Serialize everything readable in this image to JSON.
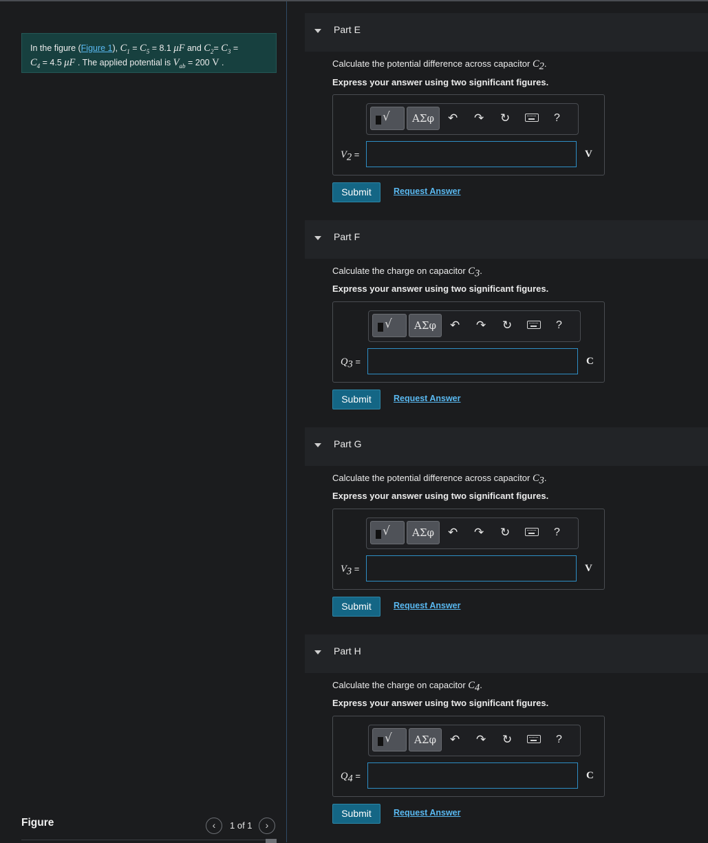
{
  "problem": {
    "intro": "In the figure (",
    "figure_link": "Figure 1",
    "after_link": "), ",
    "c1": "C",
    "c1_sub": "1",
    "eq1": " = ",
    "c5": "C",
    "c5_sub": "5",
    "eq2": " = 8.1 ",
    "unit_uf1": "μF",
    "and": " and ",
    "c2": "C",
    "c2_sub": "2",
    "eq3": "= ",
    "c3": "C",
    "c3_sub": "3",
    "eq4": " = ",
    "c4": "C",
    "c4_sub": "4",
    "eq5": " = 4.5 ",
    "unit_uf2": "μF",
    "applied": " . The applied potential is ",
    "v": "V",
    "v_sub": "ab",
    "eq6": " = 200 ",
    "unit_v": "V",
    "end": " ."
  },
  "figure_panel": {
    "label": "Figure",
    "pager": "1 of 1",
    "prev_icon": "chevron-left-icon",
    "next_icon": "chevron-right-icon"
  },
  "toolbar": {
    "templates_icon": "fraction-radical-icon",
    "templates_glyph": "√",
    "greek_label": "ΑΣφ",
    "undo_icon": "undo-icon",
    "redo_icon": "redo-icon",
    "reset_icon": "reset-icon",
    "keyboard_icon": "keyboard-icon",
    "help_label": "?"
  },
  "parts": [
    {
      "title": "Part E",
      "prompt": "Calculate the potential difference across capacitor ",
      "prompt_var": "C",
      "prompt_sub": "2",
      "instruction": "Express your answer using two significant figures.",
      "var": "V",
      "var_sub": "2",
      "equals": " =",
      "value": "",
      "unit": "V",
      "submit": "Submit",
      "request": "Request Answer"
    },
    {
      "title": "Part F",
      "prompt": "Calculate the charge on capacitor ",
      "prompt_var": "C",
      "prompt_sub": "3",
      "instruction": "Express your answer using two significant figures.",
      "var": "Q",
      "var_sub": "3",
      "equals": " =",
      "value": "",
      "unit": "C",
      "submit": "Submit",
      "request": "Request Answer"
    },
    {
      "title": "Part G",
      "prompt": "Calculate the potential difference across capacitor ",
      "prompt_var": "C",
      "prompt_sub": "3",
      "instruction": "Express your answer using two significant figures.",
      "var": "V",
      "var_sub": "3",
      "equals": " =",
      "value": "",
      "unit": "V",
      "submit": "Submit",
      "request": "Request Answer"
    },
    {
      "title": "Part H",
      "prompt": "Calculate the charge on capacitor ",
      "prompt_var": "C",
      "prompt_sub": "4",
      "instruction": "Express your answer using two significant figures.",
      "var": "Q",
      "var_sub": "4",
      "equals": " =",
      "value": "",
      "unit": "C",
      "submit": "Submit",
      "request": "Request Answer"
    }
  ],
  "colors": {
    "background": "#1b1c1e",
    "problem_box": "#17403f",
    "accent_link": "#59b8f0",
    "submit": "#146685",
    "input_border": "#2e8fc6"
  }
}
